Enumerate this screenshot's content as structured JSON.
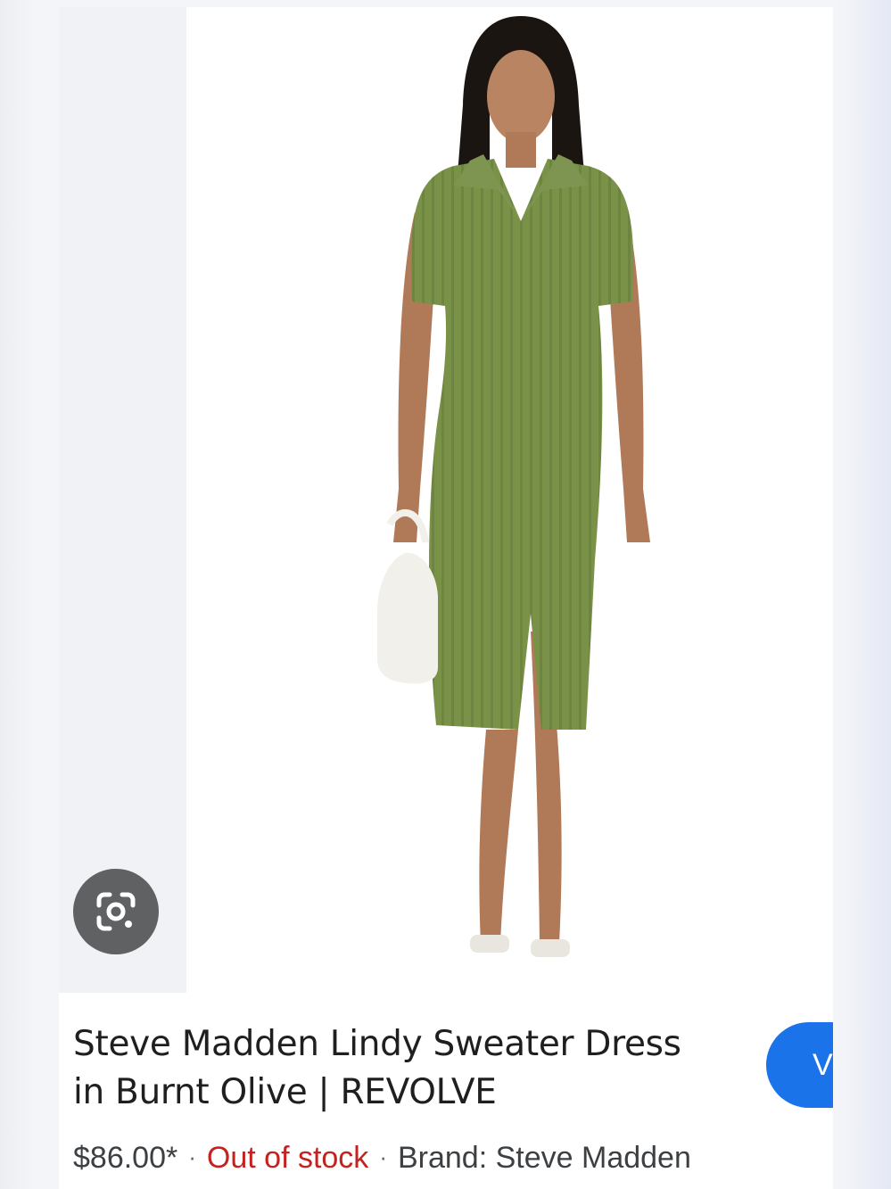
{
  "product": {
    "title_line1": "Steve Madden Lindy Sweater Dress",
    "title_line2": "in Burnt Olive | REVOLVE",
    "price": "$86.00*",
    "separator": "·",
    "stock_status": "Out of stock",
    "brand": "Brand: Steve Madden"
  },
  "actions": {
    "visit_label": "V",
    "lens_icon": "google-lens-icon"
  },
  "colors": {
    "accent_blue": "#1a73e8",
    "out_of_stock_red": "#c5221f",
    "dress_olive": "#7a9248",
    "lens_button_gray": "#5f6163"
  }
}
